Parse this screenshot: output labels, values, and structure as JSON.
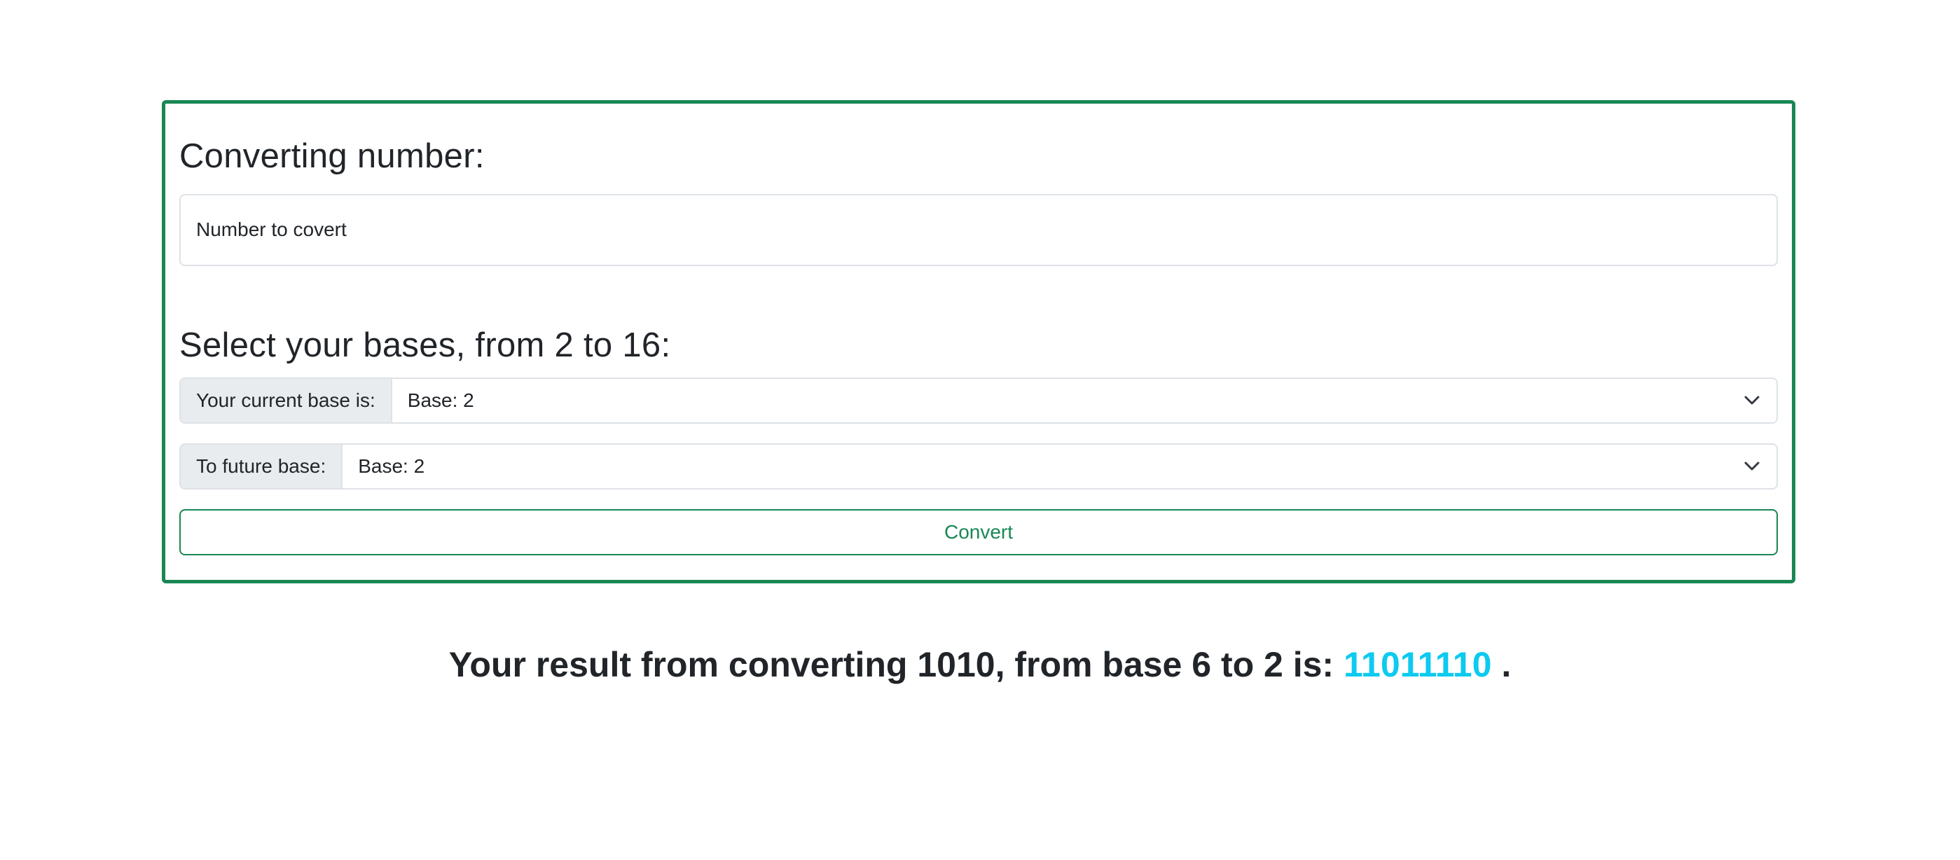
{
  "converter": {
    "heading": "Converting number:",
    "number_input": {
      "placeholder": "Number to covert",
      "value": ""
    },
    "bases_heading": "Select your bases, from 2 to 16:",
    "current_base": {
      "label": "Your current base is:",
      "selected": "Base: 2",
      "icon": "chevron-down-icon"
    },
    "future_base": {
      "label": "To future base:",
      "selected": "Base: 2",
      "icon": "chevron-down-icon"
    },
    "convert_label": "Convert"
  },
  "result": {
    "prefix": "Your result from converting 1010, from base 6 to 2 is:",
    "value": "11011110",
    "suffix": "."
  },
  "colors": {
    "accent_green": "#198754",
    "result_cyan": "#0dcaf0",
    "label_bg": "#e9ecef",
    "border": "#dee2e6"
  }
}
